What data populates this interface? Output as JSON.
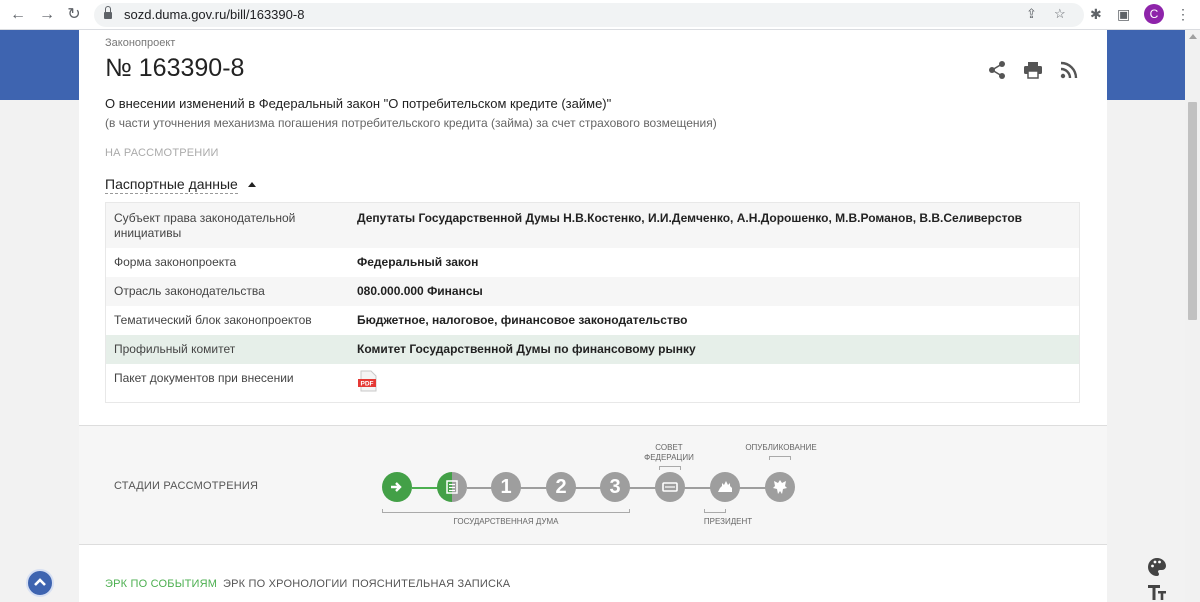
{
  "browser": {
    "url": "sozd.duma.gov.ru/bill/163390-8",
    "profile_initial": "C"
  },
  "bill": {
    "type_label": "Законопроект",
    "number": "№ 163390-8",
    "title": "О внесении изменений в Федеральный закон \"О потребительском кредите (займе)\"",
    "subtitle": "(в части уточнения механизма погашения потребительского кредита (займа) за счет страхового возмещения)",
    "status": "НА РАССМОТРЕНИИ",
    "actions": [
      "share-icon",
      "print-icon",
      "rss-icon"
    ]
  },
  "passport": {
    "toggle_label": "Паспортные данные",
    "rows": [
      {
        "key": "Субъект права законодательной инициативы",
        "value": "Депутаты Государственной Думы Н.В.Костенко, И.И.Демченко, А.Н.Дорошенко, М.В.Романов, В.В.Селиверстов"
      },
      {
        "key": "Форма законопроекта",
        "value": "Федеральный закон"
      },
      {
        "key": "Отрасль законодательства",
        "value": "080.000.000 Финансы"
      },
      {
        "key": "Тематический блок законопроектов",
        "value": "Бюджетное, налоговое, финансовое законодательство"
      },
      {
        "key": "Профильный комитет",
        "value": "Комитет Государственной Думы по финансовому рынку"
      },
      {
        "key": "Пакет документов при внесении",
        "value": ""
      }
    ],
    "pdf_label": "PDF"
  },
  "stages": {
    "label": "СТАДИИ РАССМОТРЕНИЯ",
    "numbers": [
      "1",
      "2",
      "3"
    ],
    "caption_federation_line1": "СОВЕТ",
    "caption_federation_line2": "ФЕДЕРАЦИИ",
    "caption_publication": "ОПУБЛИКОВАНИЕ",
    "caption_duma": "ГОСУДАРСТВЕННАЯ ДУМА",
    "caption_president": "ПРЕЗИДЕНТ",
    "colors": {
      "active": "#4caf50",
      "inactive": "#9e9e9e"
    }
  },
  "tabs": [
    {
      "label": "ЭРК ПО СОБЫТИЯМ",
      "active": true
    },
    {
      "label": "ЭРК ПО ХРОНОЛОГИИ",
      "active": false
    },
    {
      "label": "ПОЯСНИТЕЛЬНАЯ ЗАПИСКА",
      "active": false
    }
  ]
}
